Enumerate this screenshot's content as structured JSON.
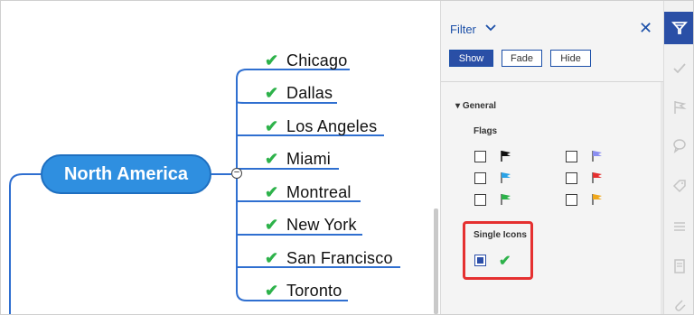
{
  "mindmap": {
    "root": "North America",
    "collapse_symbol": "−",
    "topics": [
      "Chicago",
      "Dallas",
      "Los Angeles",
      "Miami",
      "Montreal",
      "New York",
      "San Francisco",
      "Toronto"
    ],
    "check_symbol": "✔",
    "colors": {
      "root_fill": "#2f8fe0",
      "branch_line": "#2f6fd0",
      "check": "#2db24a"
    }
  },
  "filter_panel": {
    "title": "Filter",
    "close_symbol": "✕",
    "buttons": {
      "show": "Show",
      "fade": "Fade",
      "hide": "Hide"
    },
    "section": "General",
    "flags_label": "Flags",
    "flag_colors": [
      "#111111",
      "#8a8ef0",
      "#2aa2e6",
      "#e53030",
      "#2db24a",
      "#f0a81c"
    ],
    "single_icons_label": "Single Icons",
    "single_icon_checked": true,
    "single_icon_symbol": "✔"
  },
  "right_rail": {
    "icons": [
      "filter-icon",
      "check-icon",
      "flag-icon",
      "comment-icon",
      "tag-icon",
      "list-icon",
      "note-icon",
      "attachment-icon"
    ],
    "active": "filter-icon"
  }
}
